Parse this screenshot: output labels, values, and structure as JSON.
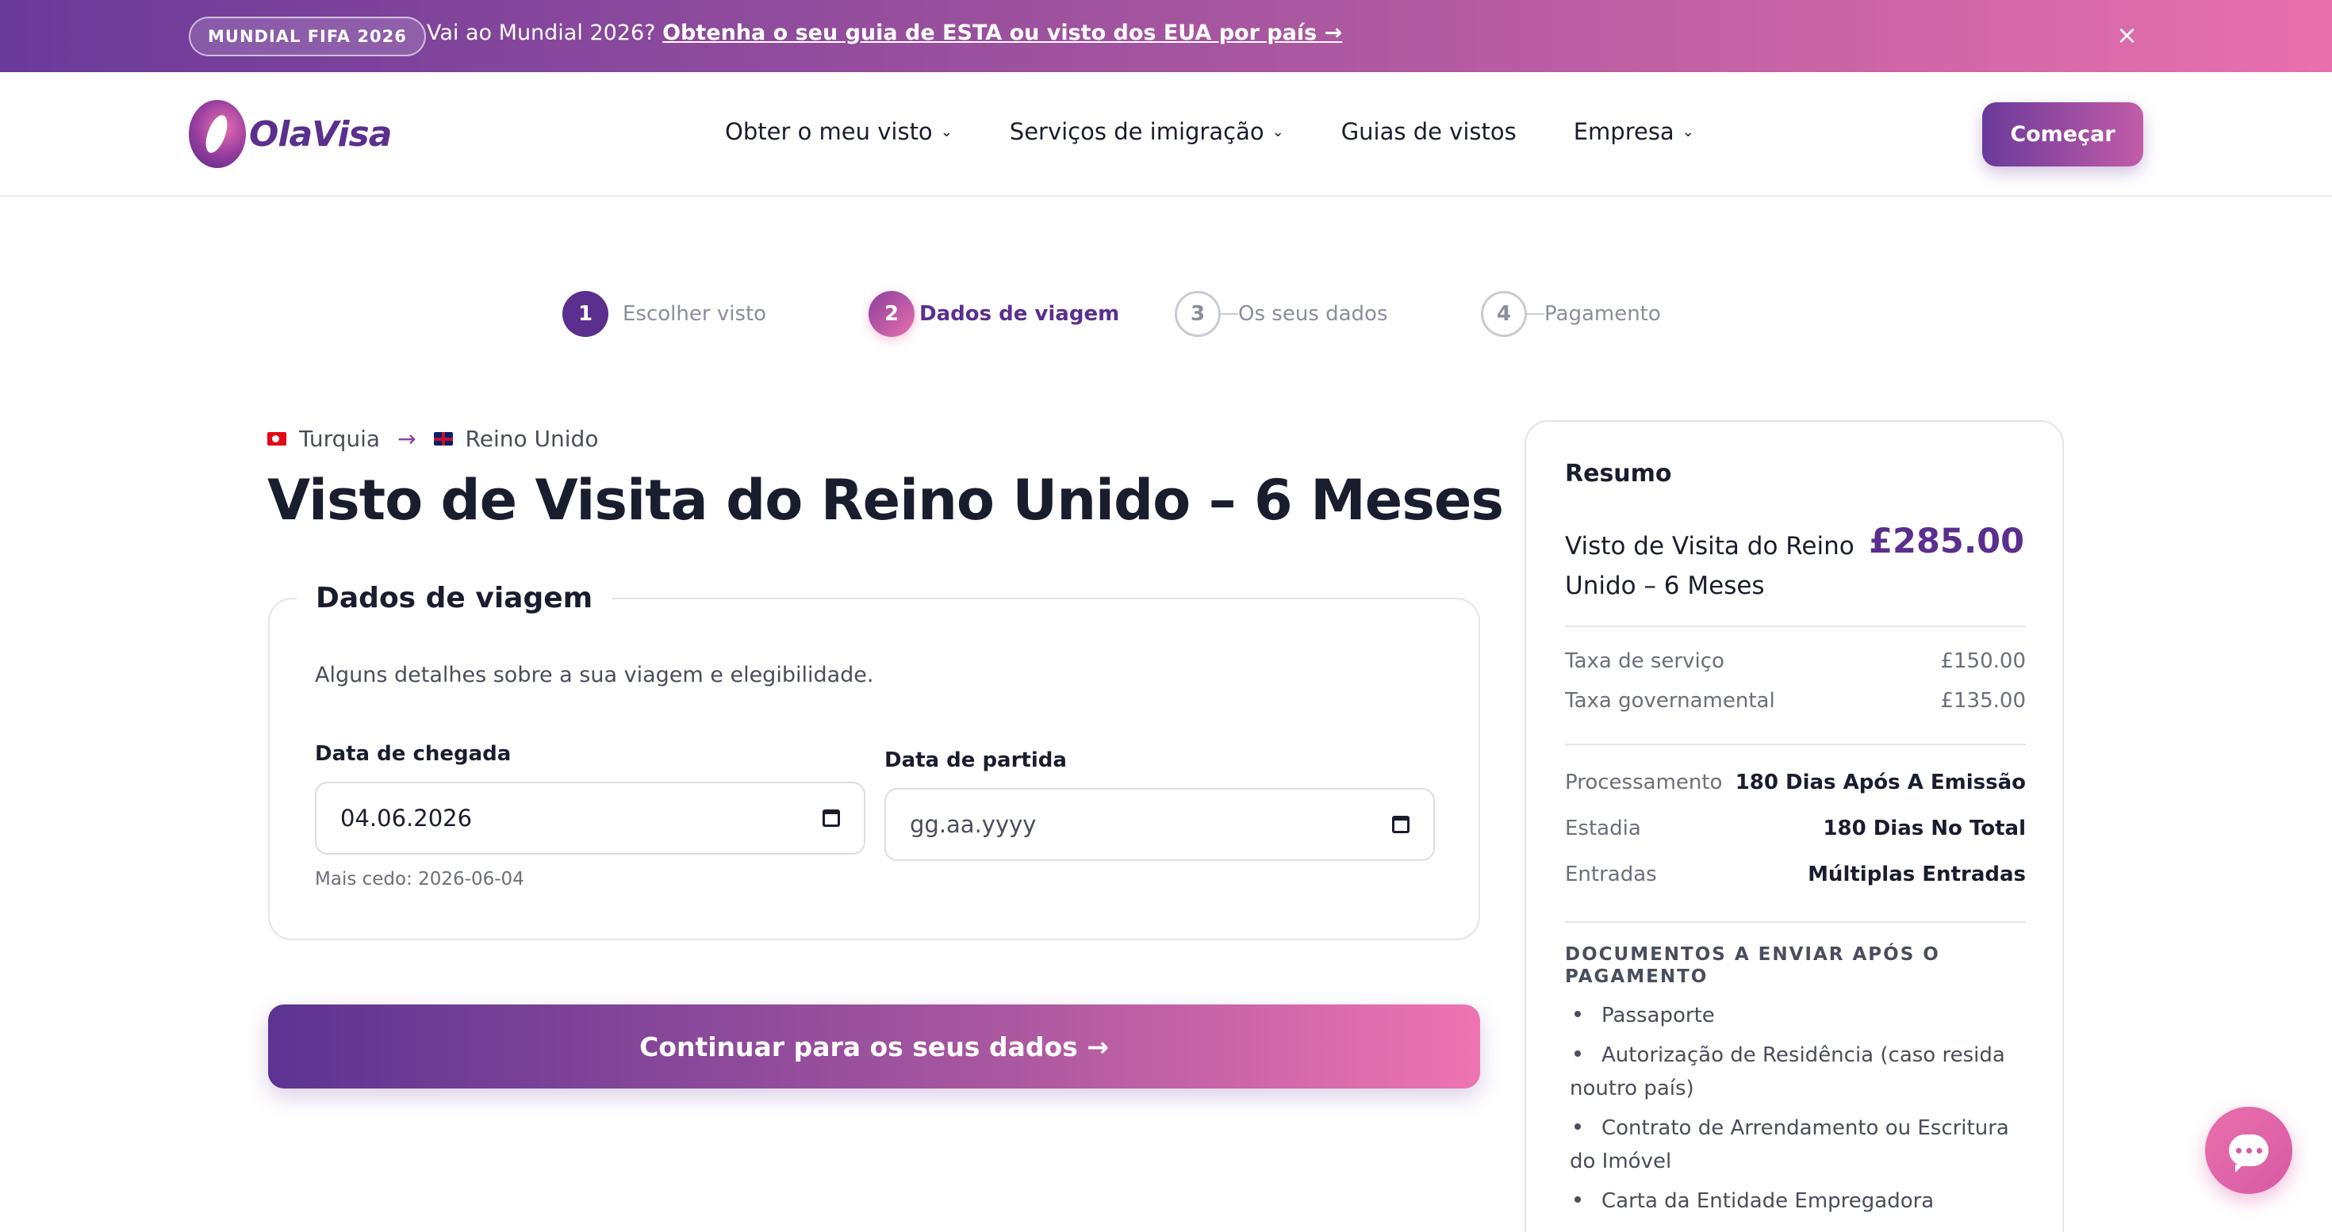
{
  "promo": {
    "badge": "MUNDIAL FIFA 2026",
    "text": "Vai ao Mundial 2026?",
    "link": "Obtenha o seu guia de ESTA ou visto dos EUA por país →",
    "close": "×"
  },
  "header": {
    "logo": "OlaVisa",
    "nav": [
      "Obter o meu visto",
      "Serviços de imigração",
      "Guias de vistos",
      "Empresa"
    ],
    "chevron": "⌄",
    "start": "Começar"
  },
  "steps": [
    {
      "num": "1",
      "label": "Escolher visto"
    },
    {
      "num": "2",
      "label": "Dados de viagem"
    },
    {
      "num": "3",
      "label": "Os seus dados"
    },
    {
      "num": "4",
      "label": "Pagamento"
    }
  ],
  "route": {
    "from": "Turquia",
    "arrow": "→",
    "to": "Reino Unido"
  },
  "title": "Visto de Visita do Reino Unido – 6 Meses",
  "form": {
    "legend": "Dados de viagem",
    "description": "Alguns detalhes sobre a sua viagem e elegibilidade.",
    "arrival_label": "Data de chegada",
    "arrival_value": "04.06.2026",
    "departure_label": "Data de partida",
    "departure_placeholder": "gg.aa.yyyy",
    "hint": "Mais cedo: 2026-06-04"
  },
  "continue": "Continuar para os seus dados →",
  "summary": {
    "title": "Resumo",
    "name": "Visto de Visita do Reino Unido – 6 Meses",
    "price": "£285.00",
    "fees": [
      {
        "k": "Taxa de serviço",
        "v": "£150.00"
      },
      {
        "k": "Taxa governamental",
        "v": "£135.00"
      }
    ],
    "details": [
      {
        "k": "Processamento",
        "v": "180 Dias Após A Emissão"
      },
      {
        "k": "Estadia",
        "v": "180 Dias No Total"
      },
      {
        "k": "Entradas",
        "v": "Múltiplas Entradas"
      }
    ],
    "docs_title": "DOCUMENTOS A ENVIAR APÓS O PAGAMENTO",
    "docs": [
      "Passaporte",
      "Autorização de Residência (caso resida noutro país)",
      "Contrato de Arrendamento ou Escritura do Imóvel",
      "Carta da Entidade Empregadora"
    ]
  }
}
